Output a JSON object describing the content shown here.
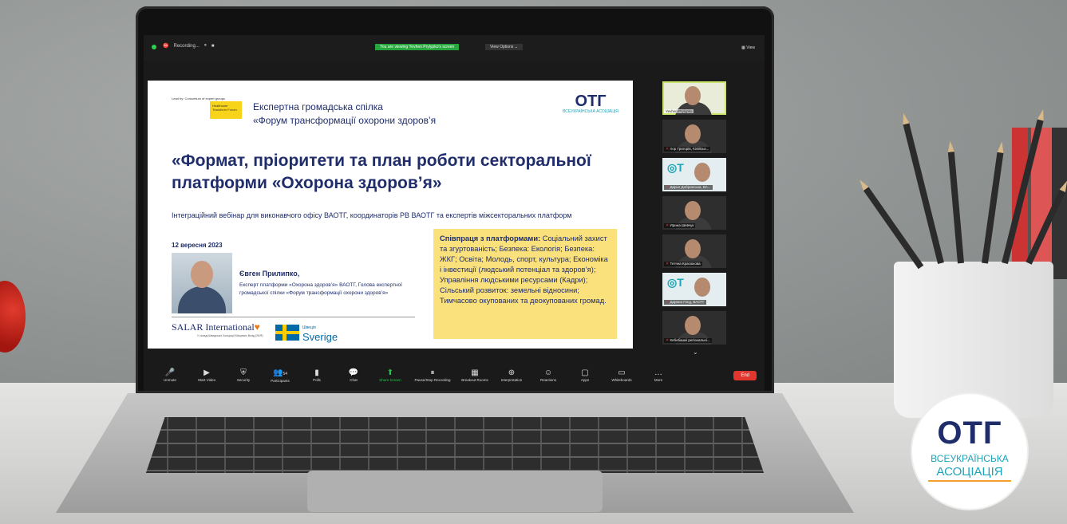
{
  "zoom": {
    "recording_label": "Recording...",
    "viewing_banner": "You are viewing Yevhen Prylypko's screen",
    "view_options": "View Options",
    "view_button": "View"
  },
  "slide": {
    "led_by": "Lead by: Consortium of expert groups",
    "hfr_label": "Healthcare Transform Forum",
    "org_line1": "Експертна громадська спілка",
    "org_line2": "«Форум трансформації охорони здоров’я",
    "otg_big": "ОТГ",
    "otg_small": "ВСЕУКРАЇНСЬКА АСОЦІАЦІЯ",
    "title": "«Формат, пріоритети та план роботи секторальної платформи «Охорона здоров’я»",
    "subtitle": "Інтеграційний вебінар для виконавчого офісу ВАОТГ, координаторів РВ ВАОТГ та експертів міжсекторальних платформ",
    "date": "12 вересня 2023",
    "speaker_name": "Євген Прилипко,",
    "speaker_role": "Експерт платформи «Охорона здоров’я» ВАОТГ, Голова експертної громадської спілки «Форум трансформації охорони здоров’я»",
    "salar": "SALAR International",
    "salar_sub": "У складі Шведської Асоціації Місцевих Влад (SKR)",
    "sweden_small": "Швеція",
    "sweden_big": "Sverige",
    "coop_bold": "Співпраця з платформами:",
    "coop_text": " Соціальний захист та згуртованість; Безпека: Екологія; Безпека: ЖКГ; Освіта; Молодь, спорт, культура; Економіка і інвестиції (людський потенціал та здоров’я); Управління людськими ресурсами (Кадри); Сільський розвиток: земельні відносини; Тимчасово окупованих та деокупованих громад."
  },
  "participants": [
    {
      "name": "Yevhen Prylypko"
    },
    {
      "name": "Ігор Григорів, Кілійськ..."
    },
    {
      "name": "Дарья Добранська, ВА..."
    },
    {
      "name": "Ирина Шевчук"
    },
    {
      "name": "Тетяна Красюкова"
    },
    {
      "name": "Дарина Гнєд, ВАОТГ"
    },
    {
      "name": "Кебебашкі регіональні..."
    }
  ],
  "toolbar": [
    {
      "label": "Unmute",
      "icon": "🎤"
    },
    {
      "label": "Start Video",
      "icon": "▶"
    },
    {
      "label": "Security",
      "icon": "⛨"
    },
    {
      "label": "Participants",
      "icon": "👥",
      "count": "54"
    },
    {
      "label": "Polls",
      "icon": "▮"
    },
    {
      "label": "Chat",
      "icon": "💬"
    },
    {
      "label": "Share Screen",
      "icon": "⬆"
    },
    {
      "label": "Pause/Stop Recording",
      "icon": "⏸"
    },
    {
      "label": "Breakout Rooms",
      "icon": "▦"
    },
    {
      "label": "Interpretation",
      "icon": "⊕"
    },
    {
      "label": "Reactions",
      "icon": "☺"
    },
    {
      "label": "Apps",
      "icon": "▢"
    },
    {
      "label": "Whiteboards",
      "icon": "▭"
    },
    {
      "label": "More",
      "icon": "…"
    }
  ],
  "end_label": "End",
  "badge": {
    "big": "ОТГ",
    "line1": "ВСЕУКРАЇНСЬКА",
    "line2": "АСОЦІАЦІЯ"
  }
}
